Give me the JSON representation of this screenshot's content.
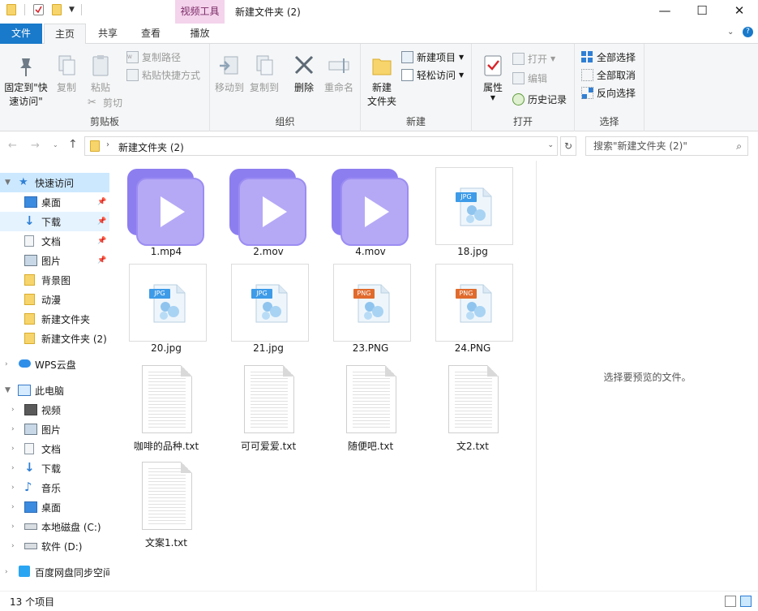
{
  "window": {
    "context_tab": "视频工具",
    "title": "新建文件夹 (2)",
    "min_symbol": "—",
    "max_symbol": "☐",
    "close_symbol": "✕"
  },
  "tabs": {
    "file": "文件",
    "home": "主页",
    "share": "共享",
    "view": "查看",
    "play": "播放"
  },
  "ribbon": {
    "clipboard": {
      "label": "剪贴板",
      "pin": "固定到\"快\n速访问\"",
      "copy": "复制",
      "paste": "粘贴",
      "copy_path": "复制路径",
      "paste_shortcut": "粘贴快捷方式",
      "cut": "剪切"
    },
    "organize": {
      "label": "组织",
      "move_to": "移动到",
      "copy_to": "复制到",
      "delete": "删除",
      "rename": "重命名"
    },
    "new": {
      "label": "新建",
      "new_folder": "新建\n文件夹",
      "new_item": "新建项目",
      "easy_access": "轻松访问"
    },
    "open": {
      "label": "打开",
      "properties": "属性",
      "open": "打开",
      "edit": "编辑",
      "history": "历史记录"
    },
    "select": {
      "label": "选择",
      "select_all": "全部选择",
      "select_none": "全部取消",
      "invert": "反向选择"
    }
  },
  "address": {
    "path": "新建文件夹 (2)",
    "search_placeholder": "搜索\"新建文件夹 (2)\""
  },
  "nav": {
    "quick_access": "快速访问",
    "items": [
      {
        "label": "桌面",
        "icon": "desktop-icon",
        "pinned": true
      },
      {
        "label": "下载",
        "icon": "download-icon",
        "pinned": true
      },
      {
        "label": "文档",
        "icon": "document-icon",
        "pinned": true
      },
      {
        "label": "图片",
        "icon": "picture-icon",
        "pinned": true
      },
      {
        "label": "背景图",
        "icon": "folder-icon",
        "pinned": false
      },
      {
        "label": "动漫",
        "icon": "folder-icon",
        "pinned": false
      },
      {
        "label": "新建文件夹",
        "icon": "folder-icon",
        "pinned": false
      },
      {
        "label": "新建文件夹 (2)",
        "icon": "folder-icon",
        "pinned": false
      }
    ],
    "wps": "WPS云盘",
    "this_pc": "此电脑",
    "pc_items": [
      {
        "label": "视频",
        "icon": "video-icon"
      },
      {
        "label": "图片",
        "icon": "picture-icon"
      },
      {
        "label": "文档",
        "icon": "document-icon"
      },
      {
        "label": "下载",
        "icon": "download-icon"
      },
      {
        "label": "音乐",
        "icon": "music-icon"
      },
      {
        "label": "桌面",
        "icon": "desktop-icon"
      },
      {
        "label": "本地磁盘 (C:)",
        "icon": "drive-icon"
      },
      {
        "label": "软件 (D:)",
        "icon": "drive-icon"
      }
    ],
    "baidu": "百度网盘同步空间"
  },
  "files": [
    {
      "name": "1.mp4",
      "type": "video"
    },
    {
      "name": "2.mov",
      "type": "video"
    },
    {
      "name": "4.mov",
      "type": "video"
    },
    {
      "name": "18.jpg",
      "type": "jpg",
      "badge": "JPG"
    },
    {
      "name": "20.jpg",
      "type": "jpg",
      "badge": "JPG"
    },
    {
      "name": "21.jpg",
      "type": "jpg",
      "badge": "JPG"
    },
    {
      "name": "23.PNG",
      "type": "png",
      "badge": "PNG"
    },
    {
      "name": "24.PNG",
      "type": "png",
      "badge": "PNG"
    },
    {
      "name": "咖啡的品种.txt",
      "type": "txt"
    },
    {
      "name": "可可爱爱.txt",
      "type": "txt"
    },
    {
      "name": "随便吧.txt",
      "type": "txt"
    },
    {
      "name": "文2.txt",
      "type": "txt"
    },
    {
      "name": "文案1.txt",
      "type": "txt"
    }
  ],
  "preview": {
    "message": "选择要预览的文件。"
  },
  "status": {
    "count": "13 个项目"
  },
  "colors": {
    "accent": "#1979ca",
    "video_purple": "#8d7ef0",
    "jpg_blue": "#3d9be8",
    "png_orange": "#e06b2d",
    "selection": "#cce8ff"
  }
}
